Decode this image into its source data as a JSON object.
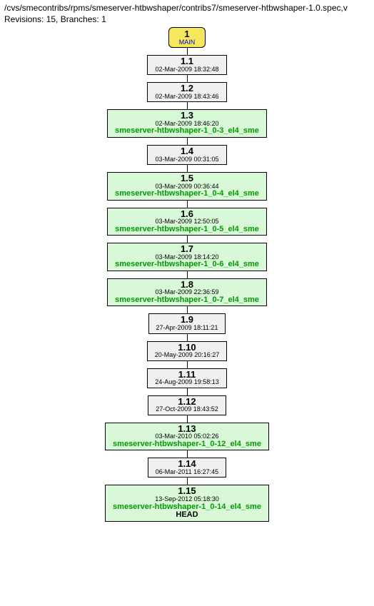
{
  "header": {
    "path": "/cvs/smecontribs/rpms/smeserver-htbwshaper/contribs7/smeserver-htbwshaper-1.0.spec,v",
    "revisions_label": "Revisions: 15, Branches: 1"
  },
  "branch": {
    "number": "1",
    "name": "MAIN"
  },
  "nodes": [
    {
      "rev": "1.1",
      "date": "02-Mar-2009 18:32:48",
      "tag": "",
      "head": ""
    },
    {
      "rev": "1.2",
      "date": "02-Mar-2009 18:43:46",
      "tag": "",
      "head": ""
    },
    {
      "rev": "1.3",
      "date": "02-Mar-2009 18:46:20",
      "tag": "smeserver-htbwshaper-1_0-3_el4_sme",
      "head": ""
    },
    {
      "rev": "1.4",
      "date": "03-Mar-2009 00:31:05",
      "tag": "",
      "head": ""
    },
    {
      "rev": "1.5",
      "date": "03-Mar-2009 00:36:44",
      "tag": "smeserver-htbwshaper-1_0-4_el4_sme",
      "head": ""
    },
    {
      "rev": "1.6",
      "date": "03-Mar-2009 12:50:05",
      "tag": "smeserver-htbwshaper-1_0-5_el4_sme",
      "head": ""
    },
    {
      "rev": "1.7",
      "date": "03-Mar-2009 18:14:20",
      "tag": "smeserver-htbwshaper-1_0-6_el4_sme",
      "head": ""
    },
    {
      "rev": "1.8",
      "date": "03-Mar-2009 22:36:59",
      "tag": "smeserver-htbwshaper-1_0-7_el4_sme",
      "head": ""
    },
    {
      "rev": "1.9",
      "date": "27-Apr-2009 18:11:21",
      "tag": "",
      "head": ""
    },
    {
      "rev": "1.10",
      "date": "20-May-2009 20:16:27",
      "tag": "",
      "head": ""
    },
    {
      "rev": "1.11",
      "date": "24-Aug-2009 19:58:13",
      "tag": "",
      "head": ""
    },
    {
      "rev": "1.12",
      "date": "27-Oct-2009 18:43:52",
      "tag": "",
      "head": ""
    },
    {
      "rev": "1.13",
      "date": "03-Mar-2010 05:02:26",
      "tag": "smeserver-htbwshaper-1_0-12_el4_sme",
      "head": ""
    },
    {
      "rev": "1.14",
      "date": "06-Mar-2011 16:27:45",
      "tag": "",
      "head": ""
    },
    {
      "rev": "1.15",
      "date": "13-Sep-2012 05:18:30",
      "tag": "smeserver-htbwshaper-1_0-14_el4_sme",
      "head": "HEAD"
    }
  ]
}
